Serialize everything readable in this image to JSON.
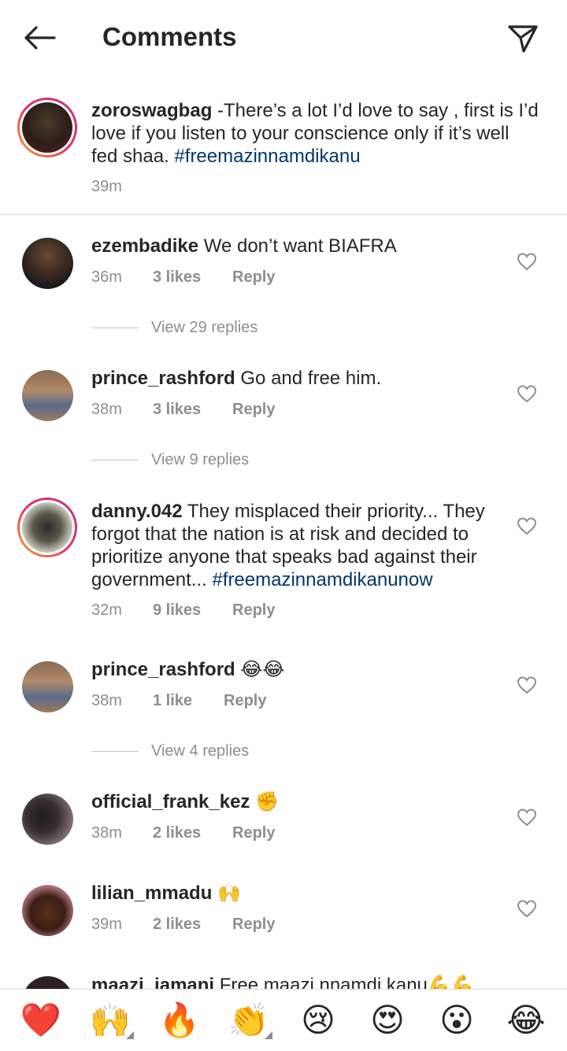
{
  "header": {
    "title": "Comments",
    "back_icon": "arrow-left-icon",
    "send_icon": "paper-plane-icon"
  },
  "caption": {
    "username": "zoroswagbag",
    "text": " -There’s a lot I’d love to say , first is I’d love if you listen to your conscience only  if it’s well fed shaa. ",
    "hashtag": "#freemazinnamdikanu",
    "time": "39m"
  },
  "comments": [
    {
      "username": "ezembadike",
      "text": " We don’t want BIAFRA",
      "time": "36m",
      "likes": "3 likes",
      "reply": "Reply",
      "view_replies": "View 29 replies"
    },
    {
      "username": "prince_rashford",
      "text": " Go and free him.",
      "time": "38m",
      "likes": "3 likes",
      "reply": "Reply",
      "view_replies": "View 9 replies"
    },
    {
      "username": "danny.042",
      "text": " They misplaced their priority... They forgot that the nation is at risk and decided to prioritize anyone that speaks bad against their government... ",
      "hashtag": "#freemazinnamdikanunow",
      "time": "32m",
      "likes": "9 likes",
      "reply": "Reply"
    },
    {
      "username": "prince_rashford",
      "text": " 😂😂",
      "time": "38m",
      "likes": "1 like",
      "reply": "Reply",
      "view_replies": "View 4 replies"
    },
    {
      "username": "official_frank_kez",
      "text": " ✊",
      "time": "38m",
      "likes": "2 likes",
      "reply": "Reply"
    },
    {
      "username": "lilian_mmadu",
      "text": " 🙌",
      "time": "39m",
      "likes": "2 likes",
      "reply": "Reply"
    },
    {
      "username": "maazi_iamani",
      "text": " Free maazi nnamdi kanu💪💪"
    }
  ],
  "quick_reactions": [
    "❤️",
    "🙌",
    "🔥",
    "👏",
    "😢",
    "😍",
    "😮",
    "😂"
  ],
  "colors": {
    "text": "#262626",
    "secondary": "#8e8e8e",
    "hashtag": "#00376b",
    "divider": "#dbdbdb"
  }
}
